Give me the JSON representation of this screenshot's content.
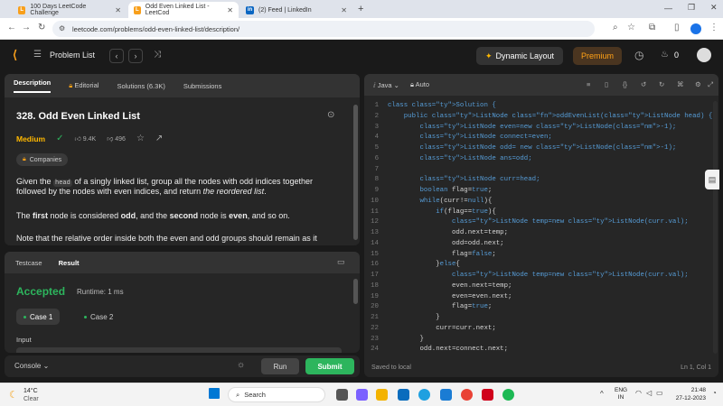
{
  "browser": {
    "tabs": [
      {
        "title": "100 Days LeetCode Challenge",
        "icon": "leetcode-tab-icon",
        "color": "#f89f1b"
      },
      {
        "title": "Odd Even Linked List - LeetCod",
        "icon": "leetcode-tab-icon",
        "color": "#f89f1b"
      },
      {
        "title": "(2) Feed | LinkedIn",
        "icon": "linkedin-tab-icon",
        "color": "#0a66c2"
      }
    ],
    "url": "leetcode.com/problems/odd-even-linked-list/description/"
  },
  "header": {
    "problem_list": "Problem List",
    "dynamic_layout": "Dynamic Layout",
    "premium": "Premium",
    "streak": "0"
  },
  "left": {
    "tabs": [
      "Description",
      "Editorial",
      "Solutions (6.3K)",
      "Submissions"
    ],
    "title": "328. Odd Even Linked List",
    "difficulty": "Medium",
    "likes": "9.4K",
    "dislikes": "496",
    "companies": "Companies",
    "p1_a": "Given the ",
    "p1_code": "head",
    "p1_b": " of a singly linked list, group all the nodes with odd indices together followed by the nodes with even indices, and return ",
    "p1_c": "the reordered list",
    "p1_d": ".",
    "p2_a": "The ",
    "p2_b": "first",
    "p2_c": " node is considered ",
    "p2_d": "odd",
    "p2_e": ", and the ",
    "p2_f": "second",
    "p2_g": " node is ",
    "p2_h": "even",
    "p2_i": ", and so on.",
    "p3": "Note that the relative order inside both the even and odd groups should remain as it"
  },
  "result": {
    "tabs": [
      "Testcase",
      "Result"
    ],
    "status": "Accepted",
    "runtime": "Runtime: 1 ms",
    "cases": [
      "Case 1",
      "Case 2"
    ],
    "input_label": "Input",
    "console": "Console",
    "run": "Run",
    "submit": "Submit"
  },
  "editor": {
    "language": "Java",
    "mode": "Auto",
    "saved": "Saved to local",
    "cursor": "Ln 1, Col 1",
    "lines": [
      "class Solution {",
      "    public ListNode oddEvenList(ListNode head) {",
      "        ListNode even=new ListNode(-1);",
      "        ListNode connect=even;",
      "        ListNode odd= new ListNode(-1);",
      "        ListNode ans=odd;",
      "",
      "        ListNode curr=head;",
      "        boolean flag=true;",
      "        while(curr!=null){",
      "            if(flag==true){",
      "                ListNode temp=new ListNode(curr.val);",
      "                odd.next=temp;",
      "                odd=odd.next;",
      "                flag=false;",
      "            }else{",
      "                ListNode temp=new ListNode(curr.val);",
      "                even.next=temp;",
      "                even=even.next;",
      "                flag=true;",
      "            }",
      "            curr=curr.next;",
      "        }",
      "        odd.next=connect.next;"
    ]
  },
  "taskbar": {
    "temp": "14°C",
    "weather": "Clear",
    "search": "Search",
    "lang": "ENG",
    "region": "IN",
    "time": "21:48",
    "date": "27-12-2023"
  }
}
